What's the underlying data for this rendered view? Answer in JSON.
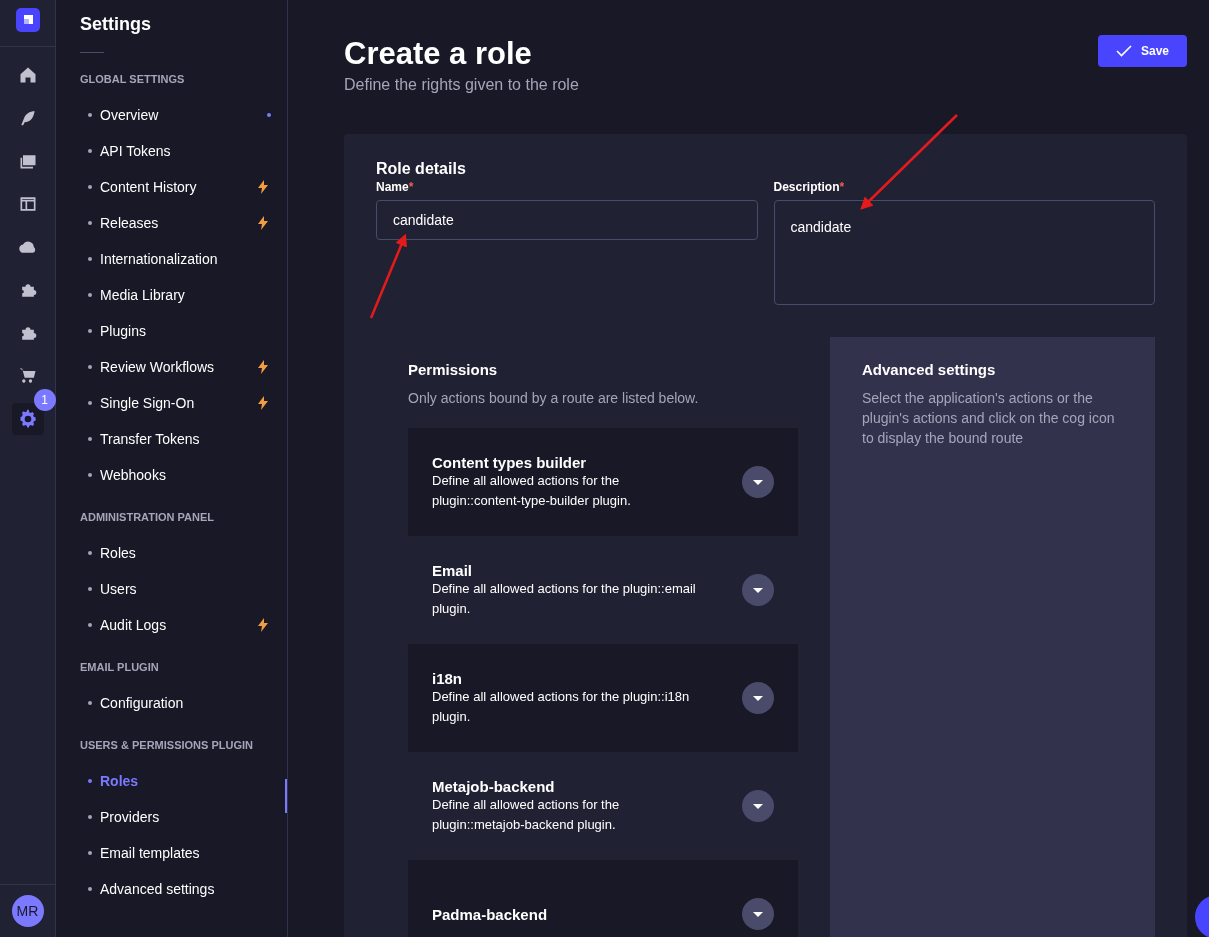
{
  "rail": {
    "items": [
      {
        "kind": "home",
        "selected": false
      },
      {
        "kind": "feather",
        "selected": false
      },
      {
        "kind": "images",
        "selected": false
      },
      {
        "kind": "layout",
        "selected": false
      },
      {
        "kind": "cloud",
        "selected": false
      },
      {
        "kind": "puzzle",
        "selected": false
      },
      {
        "kind": "puzzle",
        "selected": false
      },
      {
        "kind": "cart",
        "selected": false
      },
      {
        "kind": "gear",
        "selected": true,
        "badge": "1"
      }
    ],
    "avatar": "MR"
  },
  "settings_nav": {
    "title": "Settings",
    "sections": [
      {
        "heading": "GLOBAL SETTINGS",
        "items": [
          {
            "label": "Overview",
            "selected": false,
            "kind": "dot"
          },
          {
            "label": "API Tokens",
            "selected": false
          },
          {
            "label": "Content History",
            "selected": false,
            "kind": "bolt"
          },
          {
            "label": "Releases",
            "selected": false,
            "kind": "bolt"
          },
          {
            "label": "Internationalization",
            "selected": false
          },
          {
            "label": "Media Library",
            "selected": false
          },
          {
            "label": "Plugins",
            "selected": false
          },
          {
            "label": "Review Workflows",
            "selected": false,
            "kind": "bolt"
          },
          {
            "label": "Single Sign-On",
            "selected": false,
            "kind": "bolt"
          },
          {
            "label": "Transfer Tokens",
            "selected": false
          },
          {
            "label": "Webhooks",
            "selected": false
          }
        ]
      },
      {
        "heading": "ADMINISTRATION PANEL",
        "items": [
          {
            "label": "Roles",
            "selected": false
          },
          {
            "label": "Users",
            "selected": false
          },
          {
            "label": "Audit Logs",
            "selected": false,
            "kind": "bolt"
          }
        ]
      },
      {
        "heading": "EMAIL PLUGIN",
        "items": [
          {
            "label": "Configuration",
            "selected": false
          }
        ]
      },
      {
        "heading": "USERS & PERMISSIONS PLUGIN",
        "items": [
          {
            "label": "Roles",
            "selected": true
          },
          {
            "label": "Providers",
            "selected": false
          },
          {
            "label": "Email templates",
            "selected": false
          },
          {
            "label": "Advanced settings",
            "selected": false
          }
        ]
      }
    ]
  },
  "page": {
    "title": "Create a role",
    "subtitle": "Define the rights given to the role",
    "save_button": "Save"
  },
  "role_details": {
    "title": "Role details",
    "fields": [
      {
        "kind": "input",
        "label": "Name",
        "required_mark": "*",
        "value": "candidate"
      },
      {
        "kind": "textarea",
        "label": "Description",
        "required_mark": "*",
        "value": "candidate"
      }
    ]
  },
  "permissions": {
    "title": "Permissions",
    "subtitle": "Only actions bound by a route are listed below.",
    "groups": [
      {
        "title": "Content types builder",
        "description": "Define all allowed actions for the plugin::content-type-builder plugin.",
        "expanded": false
      },
      {
        "title": "Email",
        "description": "Define all allowed actions for the plugin::email plugin.",
        "expanded": false
      },
      {
        "title": "i18n",
        "description": "Define all allowed actions for the plugin::i18n plugin.",
        "expanded": false
      },
      {
        "title": "Metajob-backend",
        "description": "Define all allowed actions for the plugin::metajob-backend plugin.",
        "expanded": false
      },
      {
        "title": "Padma-backend",
        "expanded": false
      }
    ]
  },
  "advanced_settings": {
    "title": "Advanced settings",
    "text": "Select the application's actions or the plugin's actions and click on the cog icon to display the bound route"
  }
}
